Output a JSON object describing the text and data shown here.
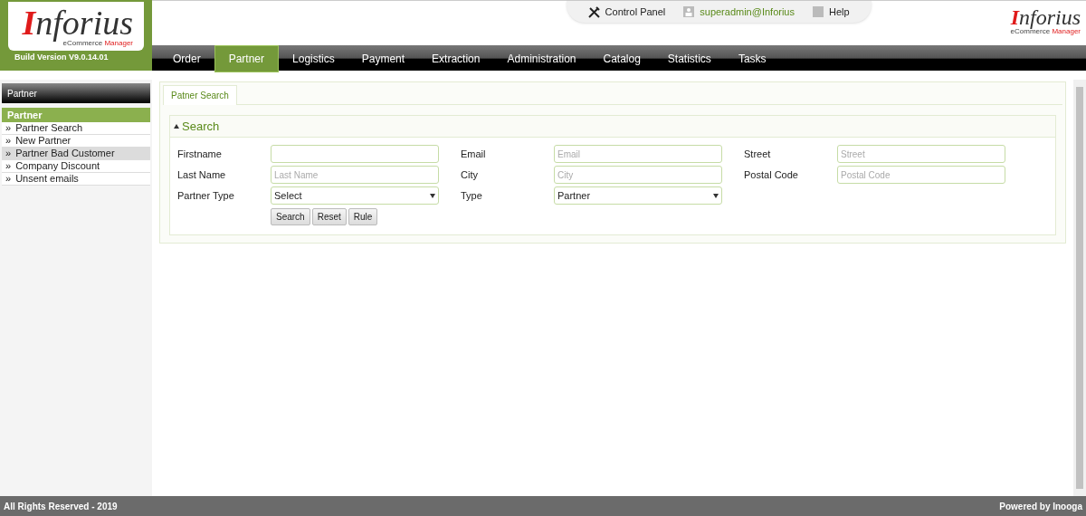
{
  "logo": {
    "text": "Inforius",
    "sub": "eCommerce",
    "sub_accent": "Manager",
    "build": "Build Version V9.0.14.01"
  },
  "corner_logo": {
    "text": "Inforius",
    "sub": "eCommerce",
    "sub_accent": "Manager"
  },
  "top_links": [
    {
      "kind": "tools",
      "label": "Control Panel"
    },
    {
      "kind": "user",
      "label": "superadmin@Inforius"
    },
    {
      "kind": "help",
      "label": "Help"
    }
  ],
  "nav": [
    {
      "label": "Order",
      "selected": false
    },
    {
      "label": "Partner",
      "selected": true
    },
    {
      "label": "Logistics",
      "selected": false
    },
    {
      "label": "Payment",
      "selected": false
    },
    {
      "label": "Extraction",
      "selected": false
    },
    {
      "label": "Administration",
      "selected": false
    },
    {
      "label": "Catalog",
      "selected": false
    },
    {
      "label": "Statistics",
      "selected": false
    },
    {
      "label": "Tasks",
      "selected": false
    }
  ],
  "sidebar": {
    "title": "Partner",
    "section": "Partner",
    "items": [
      {
        "bullet": "»",
        "label": "Partner Search",
        "selected": false
      },
      {
        "bullet": "»",
        "label": "New Partner",
        "selected": false
      },
      {
        "bullet": "»",
        "label": "Partner Bad Customer",
        "selected": true
      },
      {
        "bullet": "»",
        "label": "Company Discount",
        "selected": false
      },
      {
        "bullet": "»",
        "label": "Unsent emails",
        "selected": false
      }
    ]
  },
  "tab": "Patner Search",
  "panel_title": "Search",
  "fields": [
    {
      "label": "Firstname",
      "kind": "text"
    },
    {
      "label": "Email",
      "kind": "text",
      "placeholder": "Email"
    },
    {
      "label": "Street",
      "kind": "text",
      "placeholder": "Street"
    },
    {
      "label": "Last Name",
      "kind": "text",
      "placeholder": "Last Name"
    },
    {
      "label": "City",
      "kind": "text",
      "placeholder": "City"
    },
    {
      "label": "Postal Code",
      "kind": "text",
      "placeholder": "Postal Code"
    },
    {
      "label": "Partner Type",
      "kind": "select",
      "value": "Select"
    },
    {
      "label": "Type",
      "kind": "select",
      "value": "Partner"
    }
  ],
  "buttons": [
    "Search",
    "Reset",
    "Rule"
  ],
  "footer": {
    "left": "All Rights Reserved - 2019",
    "right": "Powered by Inooga"
  }
}
